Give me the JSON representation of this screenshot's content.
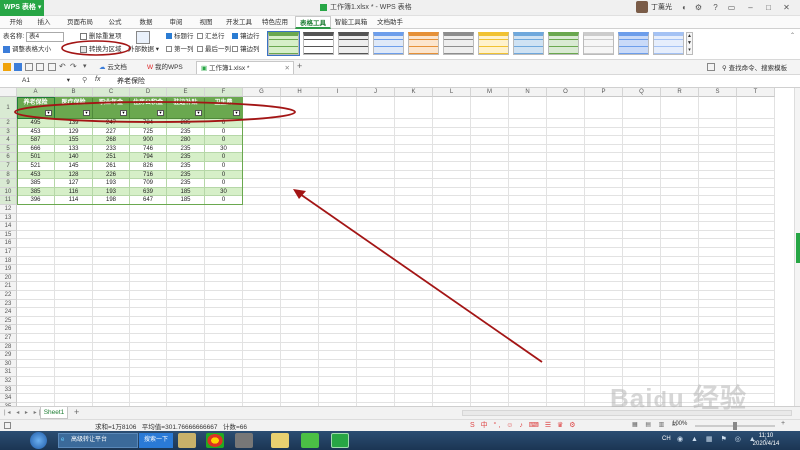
{
  "app": {
    "brand": "WPS 表格",
    "window_title": "工作簿1.xlsx * - WPS 表格",
    "user_name": "丁薰光"
  },
  "menu_tabs": [
    "开始",
    "插入",
    "页面布局",
    "公式",
    "数据",
    "审阅",
    "视图",
    "开发工具",
    "特色应用",
    "表格工具",
    "智能工具箱",
    "文档助手"
  ],
  "active_menu_tab": "表格工具",
  "ribbon": {
    "table_name_label": "表名称:",
    "table_name_value": "表4",
    "resize_label": "调整表格大小",
    "remove_dup_label": "删除重复项",
    "convert_label": "转换为区域",
    "external_label": "外部数据",
    "options": [
      {
        "label": "标题行",
        "checked": true
      },
      {
        "label": "汇总行",
        "checked": false
      },
      {
        "label": "镶边行",
        "checked": true
      },
      {
        "label": "第一列",
        "checked": false
      },
      {
        "label": "最后一列",
        "checked": false
      },
      {
        "label": "镶边列",
        "checked": false
      }
    ]
  },
  "doc_tabs": [
    {
      "label": "云文档"
    },
    {
      "label": "我的WPS"
    },
    {
      "label": "工作簿1.xlsx *"
    }
  ],
  "search_label": "查找命令、搜索模板",
  "formula_bar": {
    "name_box": "A1",
    "fx": "fx",
    "content": "养老保险"
  },
  "sheet": {
    "columns": [
      "A",
      "B",
      "C",
      "D",
      "E",
      "F",
      "G",
      "H",
      "I",
      "J",
      "K",
      "L",
      "M",
      "N",
      "O",
      "P",
      "Q",
      "R",
      "S",
      "T"
    ],
    "rows": [
      "1",
      "2",
      "3",
      "4",
      "5",
      "6",
      "7",
      "8",
      "9",
      "10",
      "11",
      "12",
      "13",
      "14",
      "15",
      "16",
      "17",
      "18",
      "19",
      "20",
      "21",
      "22",
      "23",
      "24",
      "25",
      "26",
      "27",
      "28",
      "29",
      "30",
      "31",
      "32",
      "33",
      "34",
      "35"
    ],
    "table_headers": [
      "养老保险",
      "医疗保险",
      "职业年金",
      "住房公积金",
      "驻边补贴",
      "卫生费"
    ],
    "table_rows": [
      [
        "495",
        "139",
        "247",
        "784",
        "235",
        "0"
      ],
      [
        "453",
        "129",
        "227",
        "725",
        "235",
        "0"
      ],
      [
        "587",
        "155",
        "268",
        "900",
        "280",
        "0"
      ],
      [
        "666",
        "133",
        "233",
        "746",
        "235",
        "30"
      ],
      [
        "501",
        "140",
        "251",
        "794",
        "235",
        "0"
      ],
      [
        "521",
        "145",
        "261",
        "826",
        "235",
        "0"
      ],
      [
        "453",
        "128",
        "226",
        "716",
        "235",
        "0"
      ],
      [
        "385",
        "127",
        "193",
        "709",
        "235",
        "0"
      ],
      [
        "385",
        "116",
        "193",
        "639",
        "185",
        "30"
      ],
      [
        "396",
        "114",
        "198",
        "647",
        "185",
        "0"
      ]
    ]
  },
  "sheet_tab": "Sheet1",
  "status": {
    "sum": "求和=1万8106",
    "avg": "平均值=301.76666666667",
    "count": "计数=66",
    "zoom": "100%"
  },
  "taskbar": {
    "browser_label": "高级转让平台",
    "search_label": "搜索一下",
    "lang": "CH",
    "time": "11:10",
    "date": "2020/4/14"
  },
  "colors": {
    "brand_green": "#27a645",
    "table_header": "#6aa84f",
    "band": "#d6efc8",
    "annotation": "#a31515"
  }
}
